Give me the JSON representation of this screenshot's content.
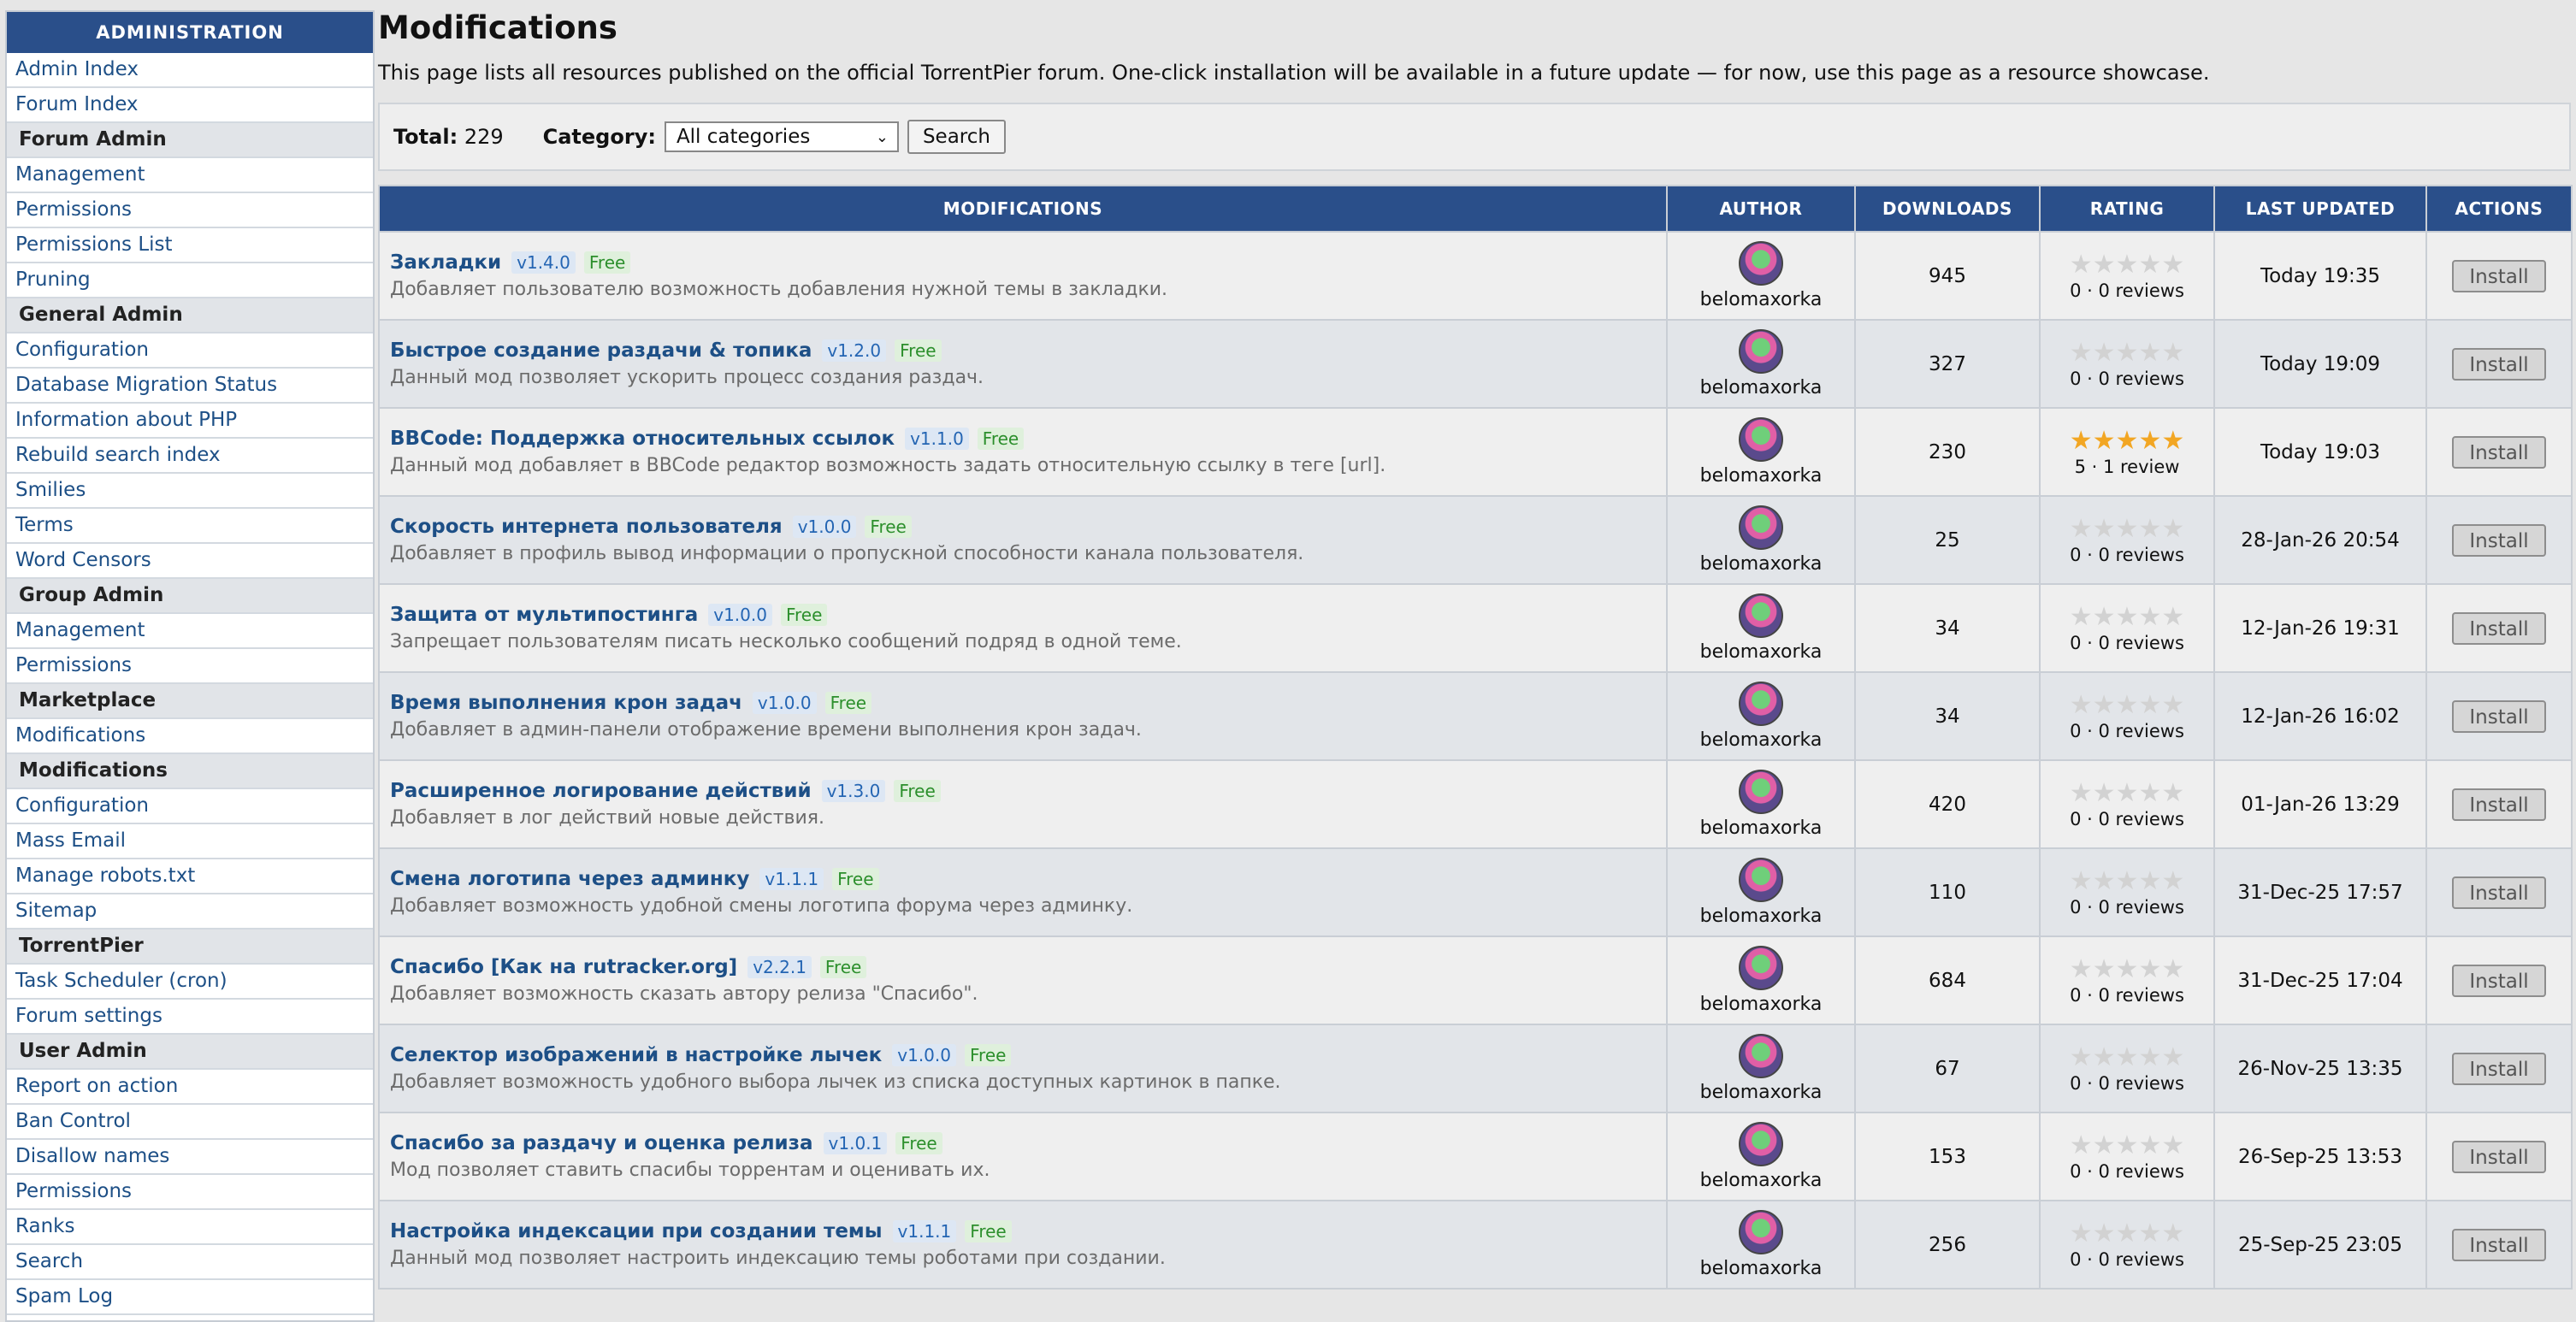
{
  "sidebar": {
    "header": "ADMINISTRATION",
    "rows": [
      {
        "label": "Admin Index",
        "type": "link"
      },
      {
        "label": "Forum Index",
        "type": "link"
      },
      {
        "label": "Forum Admin",
        "type": "cat"
      },
      {
        "label": "Management",
        "type": "link"
      },
      {
        "label": "Permissions",
        "type": "link"
      },
      {
        "label": "Permissions List",
        "type": "link"
      },
      {
        "label": "Pruning",
        "type": "link"
      },
      {
        "label": "General Admin",
        "type": "cat"
      },
      {
        "label": "Configuration",
        "type": "link"
      },
      {
        "label": "Database Migration Status",
        "type": "link"
      },
      {
        "label": "Information about PHP",
        "type": "link"
      },
      {
        "label": "Rebuild search index",
        "type": "link"
      },
      {
        "label": "Smilies",
        "type": "link"
      },
      {
        "label": "Terms",
        "type": "link"
      },
      {
        "label": "Word Censors",
        "type": "link"
      },
      {
        "label": "Group Admin",
        "type": "cat"
      },
      {
        "label": "Management",
        "type": "link"
      },
      {
        "label": "Permissions",
        "type": "link"
      },
      {
        "label": "Marketplace",
        "type": "cat"
      },
      {
        "label": "Modifications",
        "type": "link"
      },
      {
        "label": "Modifications",
        "type": "cat"
      },
      {
        "label": "Configuration",
        "type": "link"
      },
      {
        "label": "Mass Email",
        "type": "link"
      },
      {
        "label": "Manage robots.txt",
        "type": "link"
      },
      {
        "label": "Sitemap",
        "type": "link"
      },
      {
        "label": "TorrentPier",
        "type": "cat"
      },
      {
        "label": "Task Scheduler (cron)",
        "type": "link"
      },
      {
        "label": "Forum settings",
        "type": "link"
      },
      {
        "label": "User Admin",
        "type": "cat"
      },
      {
        "label": "Report on action",
        "type": "link"
      },
      {
        "label": "Ban Control",
        "type": "link"
      },
      {
        "label": "Disallow names",
        "type": "link"
      },
      {
        "label": "Permissions",
        "type": "link"
      },
      {
        "label": "Ranks",
        "type": "link"
      },
      {
        "label": "Search",
        "type": "link"
      },
      {
        "label": "Spam Log",
        "type": "link"
      }
    ]
  },
  "page": {
    "title": "Modifications",
    "description": "This page lists all resources published on the official TorrentPier forum. One-click installation will be available in a future update — for now, use this page as a resource showcase."
  },
  "filter": {
    "total_label": "Total:",
    "total_value": "229",
    "category_label": "Category:",
    "category_selected": "All categories",
    "search_label": "Search"
  },
  "table": {
    "headers": {
      "modifications": "MODIFICATIONS",
      "author": "AUTHOR",
      "downloads": "DOWNLOADS",
      "rating": "RATING",
      "last_updated": "LAST UPDATED",
      "actions": "ACTIONS"
    },
    "install_label": "Install",
    "rows": [
      {
        "name": "Закладки",
        "version": "v1.4.0",
        "price": "Free",
        "desc": "Добавляет пользователю возможность добавления нужной темы в закладки.",
        "author": "belomaxorka",
        "downloads": "945",
        "stars": 0,
        "rating_text": "0 · 0 reviews",
        "updated": "Today 19:35"
      },
      {
        "name": "Быстрое создание раздачи & топика",
        "version": "v1.2.0",
        "price": "Free",
        "desc": "Данный мод позволяет ускорить процесс создания раздач.",
        "author": "belomaxorka",
        "downloads": "327",
        "stars": 0,
        "rating_text": "0 · 0 reviews",
        "updated": "Today 19:09"
      },
      {
        "name": "BBCode: Поддержка относительных ссылок",
        "version": "v1.1.0",
        "price": "Free",
        "desc": "Данный мод добавляет в BBCode редактор возможность задать относительную ссылку в теге [url].",
        "author": "belomaxorka",
        "downloads": "230",
        "stars": 5,
        "rating_text": "5 · 1 review",
        "updated": "Today 19:03"
      },
      {
        "name": "Скорость интернета пользователя",
        "version": "v1.0.0",
        "price": "Free",
        "desc": "Добавляет в профиль вывод информации о пропускной способности канала пользователя.",
        "author": "belomaxorka",
        "downloads": "25",
        "stars": 0,
        "rating_text": "0 · 0 reviews",
        "updated": "28-Jan-26 20:54"
      },
      {
        "name": "Защита от мультипостинга",
        "version": "v1.0.0",
        "price": "Free",
        "desc": "Запрещает пользователям писать несколько сообщений подряд в одной теме.",
        "author": "belomaxorka",
        "downloads": "34",
        "stars": 0,
        "rating_text": "0 · 0 reviews",
        "updated": "12-Jan-26 19:31"
      },
      {
        "name": "Время выполнения крон задач",
        "version": "v1.0.0",
        "price": "Free",
        "desc": "Добавляет в админ-панели отображение времени выполнения крон задач.",
        "author": "belomaxorka",
        "downloads": "34",
        "stars": 0,
        "rating_text": "0 · 0 reviews",
        "updated": "12-Jan-26 16:02"
      },
      {
        "name": "Расширенное логирование действий",
        "version": "v1.3.0",
        "price": "Free",
        "desc": "Добавляет в лог действий новые действия.",
        "author": "belomaxorka",
        "downloads": "420",
        "stars": 0,
        "rating_text": "0 · 0 reviews",
        "updated": "01-Jan-26 13:29"
      },
      {
        "name": "Смена логотипа через админку",
        "version": "v1.1.1",
        "price": "Free",
        "desc": "Добавляет возможность удобной смены логотипа форума через админку.",
        "author": "belomaxorka",
        "downloads": "110",
        "stars": 0,
        "rating_text": "0 · 0 reviews",
        "updated": "31-Dec-25 17:57"
      },
      {
        "name": "Спасибо [Как на rutracker.org]",
        "version": "v2.2.1",
        "price": "Free",
        "desc": "Добавляет возможность сказать автору релиза \"Спасибо\".",
        "author": "belomaxorka",
        "downloads": "684",
        "stars": 0,
        "rating_text": "0 · 0 reviews",
        "updated": "31-Dec-25 17:04"
      },
      {
        "name": "Селектор изображений в настройке лычек",
        "version": "v1.0.0",
        "price": "Free",
        "desc": "Добавляет возможность удобного выбора лычек из списка доступных картинок в папке.",
        "author": "belomaxorka",
        "downloads": "67",
        "stars": 0,
        "rating_text": "0 · 0 reviews",
        "updated": "26-Nov-25 13:35"
      },
      {
        "name": "Спасибо за раздачу и оценка релиза",
        "version": "v1.0.1",
        "price": "Free",
        "desc": "Мод позволяет ставить спасибы торрентам и оценивать их.",
        "author": "belomaxorka",
        "downloads": "153",
        "stars": 0,
        "rating_text": "0 · 0 reviews",
        "updated": "26-Sep-25 13:53"
      },
      {
        "name": "Настройка индексации при создании темы",
        "version": "v1.1.1",
        "price": "Free",
        "desc": "Данный мод позволяет настроить индексацию темы роботами при создании.",
        "author": "belomaxorka",
        "downloads": "256",
        "stars": 0,
        "rating_text": "0 · 0 reviews",
        "updated": "25-Sep-25 23:05"
      }
    ]
  }
}
